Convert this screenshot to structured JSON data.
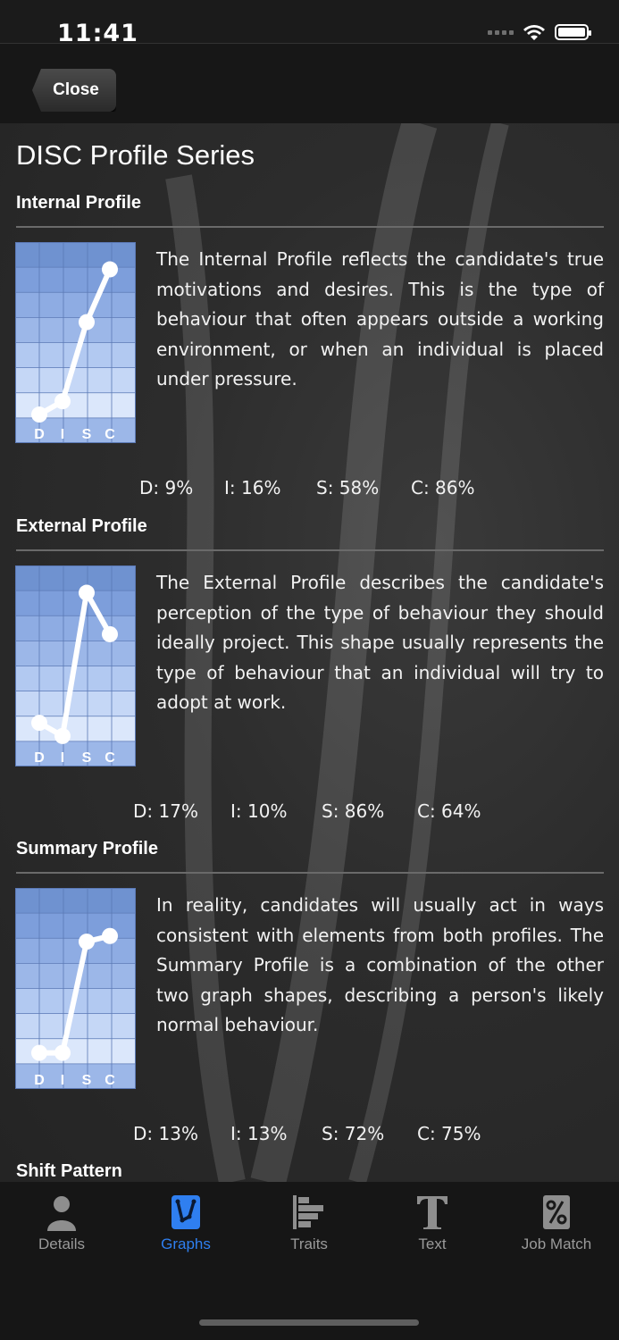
{
  "status_bar": {
    "time": "11:41"
  },
  "nav": {
    "close_label": "Close"
  },
  "page": {
    "title": "DISC Profile Series"
  },
  "disc_letters": [
    "D",
    "I",
    "S",
    "C"
  ],
  "sections": [
    {
      "heading": "Internal Profile",
      "text": "The Internal Profile reflects the candidate's true motivations and desires. This is the type of behaviour that often appears outside a working environment, or when an individual is placed under pressure.",
      "values": {
        "D": 9,
        "I": 16,
        "S": 58,
        "C": 86
      },
      "labels": [
        "D: 9%",
        "I: 16%",
        "S: 58%",
        "C: 86%"
      ]
    },
    {
      "heading": "External Profile",
      "text": "The External Profile describes the candidate's perception of the type of behaviour they should ideally project. This shape usually represents the type of behaviour that an individual will try to adopt at work.",
      "values": {
        "D": 17,
        "I": 10,
        "S": 86,
        "C": 64
      },
      "labels": [
        "D: 17%",
        "I: 10%",
        "S: 86%",
        "C: 64%"
      ]
    },
    {
      "heading": "Summary Profile",
      "text": "In reality, candidates will usually act in ways consistent with elements from both profiles. The Summary Profile is a combination of the other two graph shapes, describing a person's likely normal behaviour.",
      "values": {
        "D": 13,
        "I": 13,
        "S": 72,
        "C": 75
      },
      "labels": [
        "D: 13%",
        "I: 13%",
        "S: 72%",
        "C: 75%"
      ]
    },
    {
      "heading": "Shift Pattern"
    }
  ],
  "tabs": [
    {
      "label": "Details",
      "icon": "person-icon",
      "active": false
    },
    {
      "label": "Graphs",
      "icon": "graph-icon",
      "active": true
    },
    {
      "label": "Traits",
      "icon": "bars-icon",
      "active": false
    },
    {
      "label": "Text",
      "icon": "text-t-icon",
      "active": false
    },
    {
      "label": "Job Match",
      "icon": "percent-icon",
      "active": false
    }
  ],
  "colors": {
    "accent": "#2f7ff0",
    "inactive_tab": "#9a9a9a",
    "graph_dark": "#7a9bd4",
    "graph_light": "#dfe9fb"
  }
}
